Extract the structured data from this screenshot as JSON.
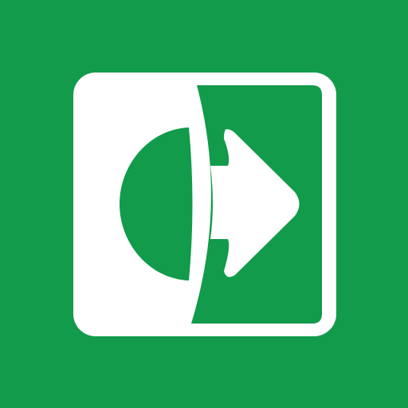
{
  "icon": {
    "name": "exit-icon",
    "colors": {
      "background": "#119b4b",
      "foreground": "#ffffff",
      "inner": "#119b4b"
    }
  }
}
